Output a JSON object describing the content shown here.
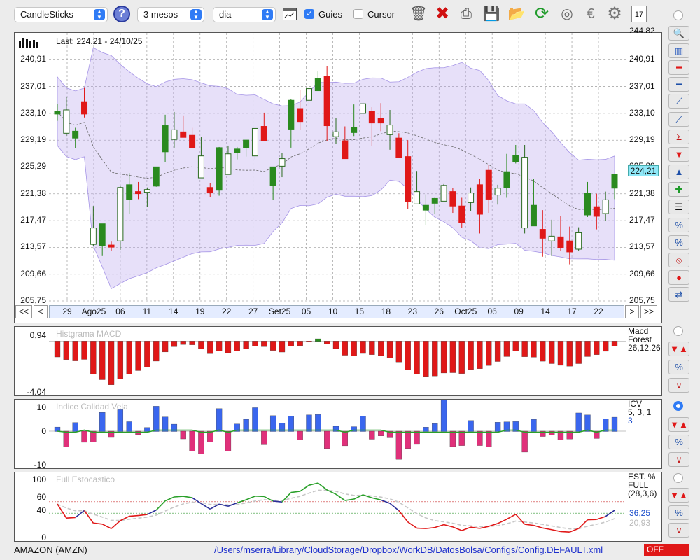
{
  "toolbar": {
    "chart_type": "CandleSticks",
    "period": "3 mesos",
    "interval": "dia",
    "guides_label": "Guies",
    "guides_checked": true,
    "cursor_label": "Cursor",
    "cursor_checked": false,
    "help": "?",
    "calendar_day": "17"
  },
  "main_chart": {
    "last_label": "Last: 224.21 - 24/10/25",
    "current_price": "224,21",
    "y_ticks": [
      "205,75",
      "209,66",
      "213,57",
      "217,47",
      "221,38",
      "225,29",
      "229,19",
      "233,10",
      "237,01",
      "240,91"
    ],
    "top_cut_label": "244,82",
    "x_labels": [
      "29",
      "Ago25",
      "06",
      "11",
      "14",
      "19",
      "22",
      "27",
      "Set25",
      "05",
      "10",
      "15",
      "18",
      "23",
      "26",
      "Oct25",
      "06",
      "09",
      "14",
      "17",
      "22"
    ],
    "nav": {
      "first": "<<",
      "prev": "<",
      "next": ">",
      "last": ">>"
    }
  },
  "macd": {
    "title": "Histgrama MACD",
    "name": "Macd",
    "name2": "Forest",
    "params": "26,12,26",
    "y_top": "0,94",
    "y_bottom": "-4,04"
  },
  "icv": {
    "title": "Indice Calidad Vela",
    "name": "ICV",
    "params": "5, 3, 1",
    "extra": "3",
    "y_top": "10",
    "y_mid": "0",
    "y_bottom": "-10"
  },
  "stoch": {
    "title": "Full Estocastico",
    "name": "EST. %",
    "name2": "FULL",
    "params": "(28,3,6)",
    "value1": "36,25",
    "value2": "20,93",
    "y_labels": [
      "100",
      "60",
      "40",
      "0"
    ]
  },
  "footer": {
    "ticker": "AMAZON (AMZN)",
    "path": "/Users/mserra/Library/CloudStorage/Dropbox/WorkDB/DatosBolsa/Configs/Config.DEFAULT.xml",
    "status": "OFF"
  },
  "colors": {
    "up": "#2a8a1f",
    "down": "#e01818",
    "band": "#b9a6ee",
    "accent": "#2f7bf5",
    "stoch_k": "#2aa02a",
    "stoch_low": "#e01818"
  },
  "chart_data": {
    "type": "candlestick",
    "ylim": [
      205.75,
      244.82
    ],
    "ohlc": [
      [
        233.0,
        234.5,
        232.0,
        233.4
      ],
      [
        233.6,
        235.5,
        229.8,
        230.2
      ],
      [
        229.5,
        231.0,
        228.0,
        230.5
      ],
      [
        234.8,
        236.8,
        232.5,
        233.0
      ],
      [
        216.4,
        219.6,
        213.8,
        214.0
      ],
      [
        213.8,
        216.7,
        212.3,
        217.0
      ],
      [
        213.9,
        214.4,
        213.1,
        213.6
      ],
      [
        214.5,
        222.6,
        213.2,
        222.3
      ],
      [
        220.5,
        224.4,
        218.4,
        222.7
      ],
      [
        221.7,
        223.1,
        220.6,
        221.4
      ],
      [
        221.6,
        222.3,
        219.5,
        222.0
      ],
      [
        222.5,
        225.3,
        222.4,
        225.3
      ],
      [
        227.5,
        232.9,
        226.0,
        231.3
      ],
      [
        229.3,
        233.3,
        228.1,
        230.7
      ],
      [
        230.4,
        232.8,
        230.0,
        229.6
      ],
      [
        229.9,
        231.0,
        228.6,
        228.1
      ],
      [
        226.9,
        229.7,
        226.0,
        223.7
      ],
      [
        222.3,
        222.9,
        220.9,
        221.5
      ],
      [
        221.9,
        228.2,
        221.1,
        228.1
      ],
      [
        227.2,
        228.4,
        224.4,
        224.2
      ],
      [
        227.4,
        228.2,
        226.4,
        227.9
      ],
      [
        228.1,
        229.2,
        226.8,
        229.2
      ],
      [
        226.9,
        230.8,
        226.4,
        230.9
      ],
      [
        231.2,
        233.2,
        229.1,
        229.1
      ],
      [
        222.6,
        225.0,
        220.5,
        225.3
      ],
      [
        225.4,
        227.3,
        223.8,
        226.5
      ],
      [
        230.8,
        235.2,
        228.1,
        235.0
      ],
      [
        233.8,
        236.5,
        230.7,
        231.9
      ],
      [
        235.0,
        236.8,
        234.1,
        236.7
      ],
      [
        236.4,
        239.2,
        236.4,
        238.2
      ],
      [
        238.5,
        240.0,
        229.1,
        231.3
      ],
      [
        229.7,
        232.4,
        228.7,
        230.4
      ],
      [
        229.1,
        231.2,
        226.5,
        226.5
      ],
      [
        230.3,
        234.4,
        229.8,
        231.1
      ],
      [
        233.1,
        234.8,
        232.4,
        234.5
      ],
      [
        233.4,
        234.0,
        228.3,
        231.7
      ],
      [
        232.4,
        234.6,
        230.5,
        231.7
      ],
      [
        231.4,
        233.6,
        227.8,
        230.0
      ],
      [
        229.5,
        230.2,
        227.6,
        226.7
      ],
      [
        226.8,
        229.2,
        219.2,
        220.2
      ],
      [
        221.7,
        224.7,
        221.1,
        219.9
      ],
      [
        219.0,
        221.3,
        216.8,
        219.7
      ],
      [
        220.0,
        220.8,
        218.4,
        220.7
      ],
      [
        220.3,
        222.8,
        220.9,
        222.6
      ],
      [
        221.7,
        222.2,
        218.6,
        219.6
      ],
      [
        219.6,
        220.8,
        216.4,
        217.2
      ],
      [
        220.1,
        222.3,
        218.9,
        221.5
      ],
      [
        222.7,
        223.5,
        215.6,
        218.4
      ],
      [
        224.8,
        225.6,
        218.6,
        220.6
      ],
      [
        221.2,
        222.7,
        219.8,
        222.2
      ],
      [
        222.3,
        227.2,
        220.8,
        224.6
      ],
      [
        226.0,
        228.5,
        225.8,
        227.0
      ],
      [
        226.7,
        228.5,
        215.6,
        216.4
      ],
      [
        216.7,
        223.6,
        217.0,
        219.7
      ],
      [
        216.2,
        219.0,
        212.2,
        214.9
      ],
      [
        215.2,
        217.6,
        212.3,
        214.5
      ],
      [
        215.1,
        218.1,
        213.1,
        213.5
      ],
      [
        214.5,
        216.6,
        211.1,
        212.9
      ],
      [
        213.3,
        216.5,
        213.1,
        215.7
      ],
      [
        218.3,
        223.1,
        218.0,
        221.5
      ],
      [
        219.5,
        221.4,
        216.2,
        218.1
      ],
      [
        218.5,
        221.7,
        217.4,
        220.5
      ],
      [
        222.2,
        224.3,
        220.6,
        224.2
      ]
    ]
  }
}
